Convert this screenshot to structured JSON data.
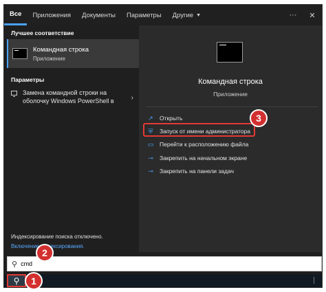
{
  "tabs": {
    "all": "Все",
    "apps": "Приложения",
    "documents": "Документы",
    "settings": "Параметры",
    "other": "Другие"
  },
  "left": {
    "best_match_title": "Лучшее соответствие",
    "best_name": "Командная строка",
    "best_type": "Приложение",
    "params_title": "Параметры",
    "param_item": "Замена командной строки на оболочку Windows PowerShell в",
    "index_status": "Индексирование поиска отключено.",
    "index_link": "Включение индексирования."
  },
  "right": {
    "app_name": "Командная строка",
    "app_type": "Приложение",
    "actions": [
      {
        "label": "Открыть",
        "icon": "open-icon"
      },
      {
        "label": "Запуск от имени администратора",
        "icon": "admin-shield-icon"
      },
      {
        "label": "Перейти к расположению файла",
        "icon": "folder-icon"
      },
      {
        "label": "Закрепить на начальном экране",
        "icon": "pin-icon"
      },
      {
        "label": "Закрепить на панели задач",
        "icon": "pin-icon"
      }
    ]
  },
  "search": {
    "value": "cmd"
  },
  "badges": {
    "one": "1",
    "two": "2",
    "three": "3"
  },
  "colors": {
    "accent": "#4aa3ff",
    "highlight": "#e53935",
    "badge": "#d32f2f"
  }
}
